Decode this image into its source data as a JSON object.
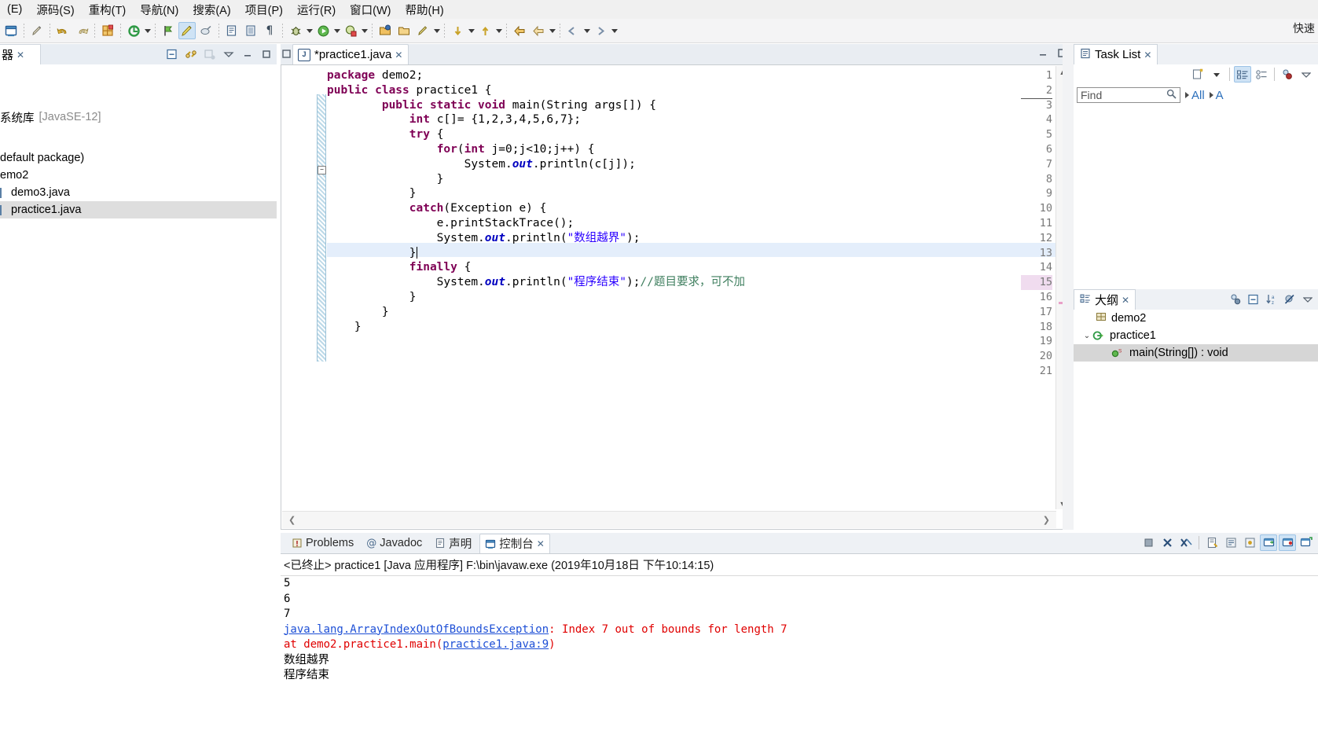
{
  "menu": {
    "items": [
      {
        "label": "(E)",
        "name": "menu-edit"
      },
      {
        "label": "源码(S)",
        "name": "menu-source"
      },
      {
        "label": "重构(T)",
        "name": "menu-refactor"
      },
      {
        "label": "导航(N)",
        "name": "menu-navigate"
      },
      {
        "label": "搜索(A)",
        "name": "menu-search"
      },
      {
        "label": "项目(P)",
        "name": "menu-project"
      },
      {
        "label": "运行(R)",
        "name": "menu-run"
      },
      {
        "label": "窗口(W)",
        "name": "menu-window"
      },
      {
        "label": "帮助(H)",
        "name": "menu-help"
      }
    ]
  },
  "toolbar": {
    "quick_access": "快速"
  },
  "package_explorer": {
    "tab_label": "器",
    "tree": [
      {
        "label": "系统库",
        "suffix": "[JavaSE-12]",
        "indent": 0,
        "selected": false
      },
      {
        "label": "",
        "suffix": "",
        "indent": 0,
        "selected": false
      },
      {
        "label": "default package)",
        "suffix": "",
        "indent": 0,
        "selected": false
      },
      {
        "label": "emo2",
        "suffix": "",
        "indent": 0,
        "selected": false
      },
      {
        "label": "demo3.java",
        "suffix": "",
        "indent": 0,
        "selected": false
      },
      {
        "label": "practice1.java",
        "suffix": "",
        "indent": 0,
        "selected": true
      }
    ]
  },
  "editor": {
    "tab_title": "*practice1.java",
    "file_icon": "java-file-icon",
    "current_line": 13,
    "marked_line": 15,
    "lines": [
      {
        "n": 1,
        "html": "<span class=\"kw\">package</span> demo2;"
      },
      {
        "n": 2,
        "html": "<span class=\"kw\">public class</span> practice1 {"
      },
      {
        "n": 3,
        "html": "        <span class=\"kw\">public static void</span> main(String args[]) {"
      },
      {
        "n": 4,
        "html": "            <span class=\"kw\">int</span> c[]= {1,2,3,4,5,6,7};"
      },
      {
        "n": 5,
        "html": "            <span class=\"kw\">try</span> {"
      },
      {
        "n": 6,
        "html": "                <span class=\"kw\">for</span>(<span class=\"kw\">int</span> j=0;j&lt;10;j++) {"
      },
      {
        "n": 7,
        "html": "                    System.<span class=\"fld\">out</span>.println(c[j]);"
      },
      {
        "n": 8,
        "html": "                }"
      },
      {
        "n": 9,
        "html": "            }"
      },
      {
        "n": 10,
        "html": "            <span class=\"kw\">catch</span>(Exception e) {"
      },
      {
        "n": 11,
        "html": "                e.printStackTrace();"
      },
      {
        "n": 12,
        "html": "                System.<span class=\"fld\">out</span>.println(<span class=\"str\">\"数组越界\"</span>);"
      },
      {
        "n": 13,
        "html": "            }"
      },
      {
        "n": 14,
        "html": "            <span class=\"kw\">finally</span> {"
      },
      {
        "n": 15,
        "html": "                System.<span class=\"fld\">out</span>.println(<span class=\"str\">\"程序结束\"</span>);<span class=\"cmt\">//题目要求，可不加</span>"
      },
      {
        "n": 16,
        "html": "            }"
      },
      {
        "n": 17,
        "html": "        }"
      },
      {
        "n": 18,
        "html": "    }"
      },
      {
        "n": 19,
        "html": ""
      },
      {
        "n": 20,
        "html": ""
      },
      {
        "n": 21,
        "html": ""
      }
    ]
  },
  "console": {
    "tabs": [
      {
        "label": "Problems",
        "icon": "problems-icon",
        "active": false
      },
      {
        "label": "Javadoc",
        "icon": "javadoc-icon",
        "active": false
      },
      {
        "label": "声明",
        "icon": "declaration-icon",
        "active": false
      },
      {
        "label": "控制台",
        "icon": "console-icon",
        "active": true
      }
    ],
    "header": "<已终止> practice1 [Java 应用程序] F:\\bin\\javaw.exe  (2019年10月18日 下午10:14:15)",
    "output": [
      {
        "type": "plain",
        "text": "5"
      },
      {
        "type": "plain",
        "text": "6"
      },
      {
        "type": "plain",
        "text": "7"
      },
      {
        "type": "exception",
        "link": "java.lang.ArrayIndexOutOfBoundsException",
        "rest": ": Index 7 out of bounds for length 7"
      },
      {
        "type": "stack",
        "pre": "        at demo2.practice1.main(",
        "link": "practice1.java:9",
        "post": ")"
      },
      {
        "type": "plain-cn",
        "text": "数组越界"
      },
      {
        "type": "plain-cn",
        "text": "程序结束"
      }
    ]
  },
  "task_list": {
    "tab_label": "Task List",
    "find_placeholder": "Find",
    "filter_all": "All",
    "filter_a": "A"
  },
  "outline": {
    "tab_label": "大纲",
    "items": [
      {
        "label": "demo2",
        "icon": "package-icon",
        "indent": 1,
        "twisty": "",
        "selected": false
      },
      {
        "label": "practice1",
        "icon": "class-icon",
        "indent": 0,
        "twisty": "v",
        "selected": false
      },
      {
        "label": "main(String[]) : void",
        "icon": "method-static-icon",
        "indent": 2,
        "twisty": "",
        "selected": true
      }
    ]
  },
  "colors": {
    "keyword": "#7f0055",
    "string": "#2a00ff",
    "comment": "#3f7f5f",
    "field": "#0000c0",
    "error": "#e00000",
    "link": "#1d4fd6",
    "current_line": "#e4eefb"
  }
}
